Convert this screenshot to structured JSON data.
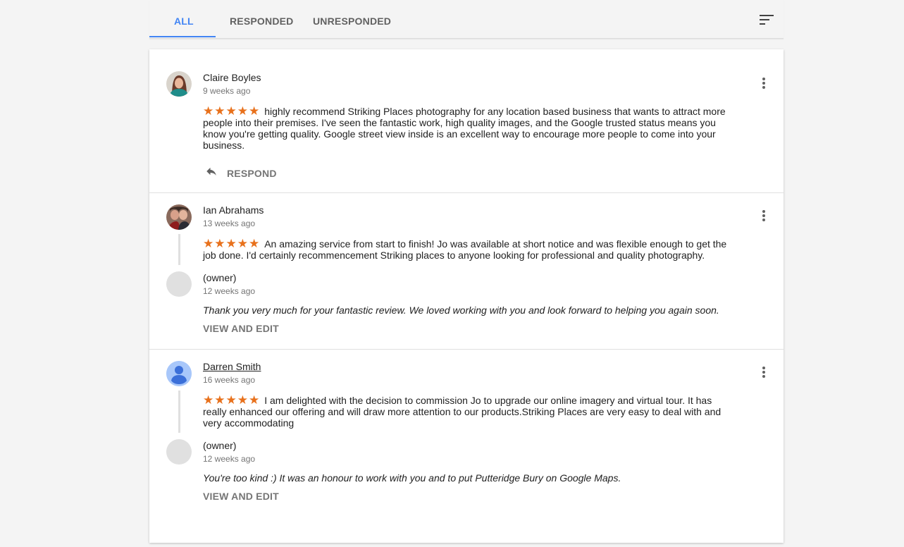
{
  "tabs": [
    {
      "label": "ALL",
      "active": true
    },
    {
      "label": "RESPONDED",
      "active": false
    },
    {
      "label": "UNRESPONDED",
      "active": false
    }
  ],
  "accent_color": "#4285f4",
  "star_color": "#e8711c",
  "icons": {
    "sort": "sort-icon",
    "more": "more-vert-icon",
    "reply": "reply-icon"
  },
  "reviews": [
    {
      "name": "Claire Boyles",
      "time": "9 weeks ago",
      "rating": 5,
      "stars": "★★★★★",
      "text": "highly recommend Striking Places photography for any location based business that wants to attract more people into their premises. I've seen the fantastic work, high quality images, and the Google trusted status means you know you're getting quality. Google street view inside is an excellent way to encourage more people to come into your business.",
      "action_label": "RESPOND"
    },
    {
      "name": "Ian Abrahams",
      "time": "13 weeks ago",
      "rating": 5,
      "stars": "★★★★★",
      "text": "An amazing service from start to finish! Jo was available at short notice and was flexible enough to get the job done. I'd certainly recommencement Striking places to anyone looking for professional and quality photography.",
      "reply": {
        "name": "(owner)",
        "time": "12 weeks ago",
        "text": "Thank you very much for your fantastic review. We loved working with you and look forward to helping you again soon.",
        "action_label": "VIEW AND EDIT"
      }
    },
    {
      "name": "Darren Smith",
      "time": "16 weeks ago",
      "rating": 5,
      "stars": "★★★★★",
      "text": "I am delighted with the decision to commission Jo to upgrade our online imagery and virtual tour. It has really enhanced our offering and will draw more attention to our products.Striking Places are very easy to deal with and very accommodating",
      "reply": {
        "name": "(owner)",
        "time": "12 weeks ago",
        "text": "You're too kind :) It was an honour to work with you and to put Putteridge Bury on Google Maps.",
        "action_label": "VIEW AND EDIT"
      }
    }
  ]
}
